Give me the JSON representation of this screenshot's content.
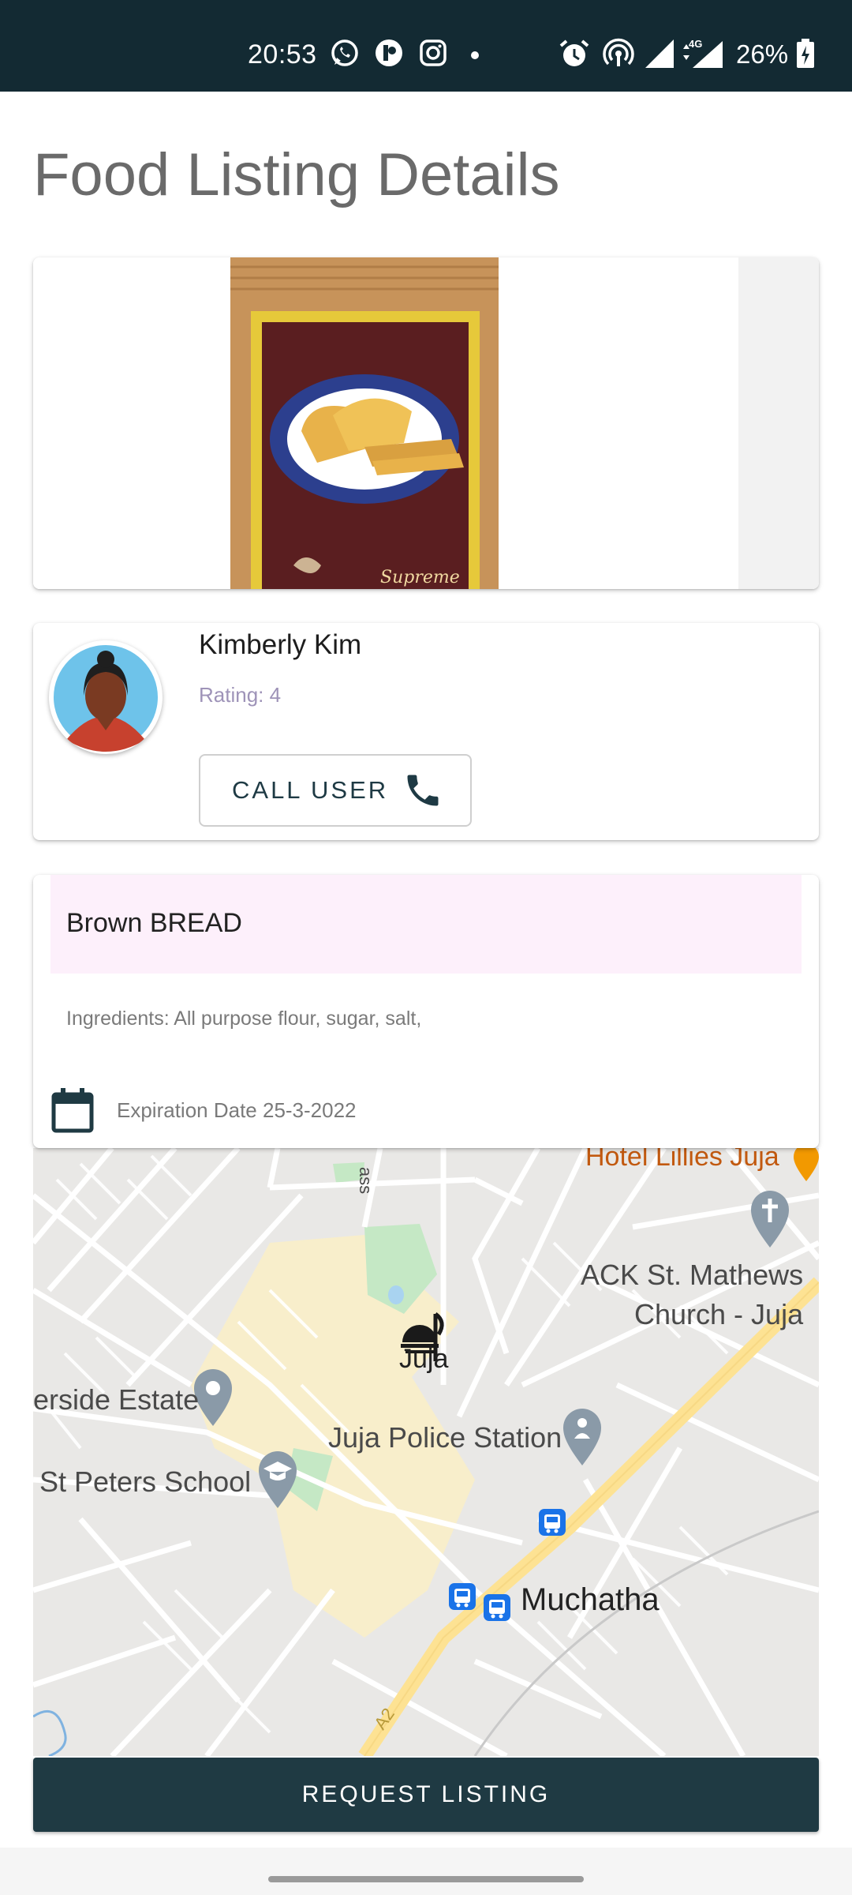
{
  "status_bar": {
    "time": "20:53",
    "battery": "26%",
    "network": "4G",
    "icons": [
      "whatsapp-icon",
      "app-icon",
      "instagram-icon",
      "dot-icon",
      "alarm-icon",
      "hotspot-icon",
      "signal-icon",
      "network-signal-icon",
      "battery-icon"
    ]
  },
  "page": {
    "title": "Food Listing Details"
  },
  "listing_image": {
    "icon": "bread-package-image",
    "brand_text": "Supreme"
  },
  "user": {
    "name": "Kimberly Kim",
    "rating": "Rating: 4",
    "call_label": "CALL USER",
    "call_icon": "phone-icon"
  },
  "food": {
    "title": "Brown BREAD",
    "ingredients": "Ingredients: All purpose flour, sugar, salt,",
    "expiration": "Expiration Date 25-3-2022",
    "expiration_icon": "calendar-icon"
  },
  "map": {
    "labels": {
      "hotel": "Hotel Lillies Juja",
      "church_line1": "ACK St. Mathews",
      "church_line2": "Church - Juja",
      "juja": "Juja",
      "estate": "erside Estate",
      "police": "Juja Police Station",
      "school": "St Peters School",
      "muchatha": "Muchatha",
      "road": "A2",
      "pass": "ass"
    },
    "colors": {
      "background": "#e9e8e6",
      "highway": "#fde293",
      "town": "#f8eecb",
      "park": "#c5e8c5"
    }
  },
  "actions": {
    "request_label": "REQUEST LISTING"
  },
  "colors": {
    "primary": "#1f3a43",
    "status_bar": "#132a33",
    "title": "#6a6a6a"
  }
}
